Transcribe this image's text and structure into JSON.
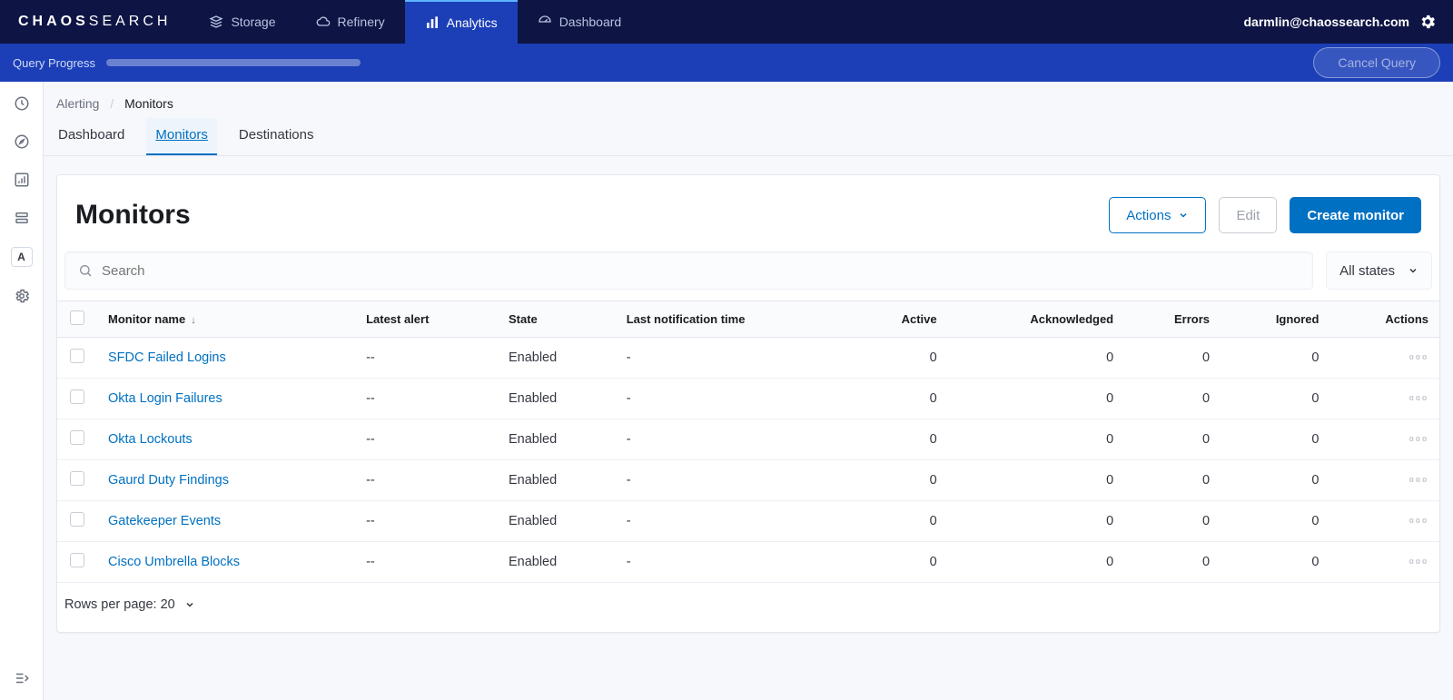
{
  "brand": {
    "part1": "CHAOS",
    "part2": "SEARCH"
  },
  "topnav": {
    "items": [
      {
        "label": "Storage",
        "icon": "storage"
      },
      {
        "label": "Refinery",
        "icon": "cloud"
      },
      {
        "label": "Analytics",
        "icon": "bars",
        "active": true
      },
      {
        "label": "Dashboard",
        "icon": "gauge"
      }
    ],
    "user": "darmlin@chaossearch.com"
  },
  "querybar": {
    "label": "Query Progress",
    "cancel": "Cancel Query"
  },
  "breadcrumb": {
    "root": "Alerting",
    "current": "Monitors"
  },
  "tabs": [
    {
      "label": "Dashboard"
    },
    {
      "label": "Monitors",
      "active": true
    },
    {
      "label": "Destinations"
    }
  ],
  "panel": {
    "title": "Monitors",
    "actions_btn": "Actions",
    "edit_btn": "Edit",
    "create_btn": "Create monitor",
    "search_placeholder": "Search",
    "state_filter": "All states"
  },
  "table": {
    "headers": {
      "name": "Monitor name",
      "latest": "Latest alert",
      "state": "State",
      "last_notif": "Last notification time",
      "active": "Active",
      "ack": "Acknowledged",
      "errors": "Errors",
      "ignored": "Ignored",
      "actions": "Actions"
    },
    "rows": [
      {
        "name": "SFDC Failed Logins",
        "latest": "--",
        "state": "Enabled",
        "last_notif": "-",
        "active": "0",
        "ack": "0",
        "errors": "0",
        "ignored": "0"
      },
      {
        "name": "Okta Login Failures",
        "latest": "--",
        "state": "Enabled",
        "last_notif": "-",
        "active": "0",
        "ack": "0",
        "errors": "0",
        "ignored": "0"
      },
      {
        "name": "Okta Lockouts",
        "latest": "--",
        "state": "Enabled",
        "last_notif": "-",
        "active": "0",
        "ack": "0",
        "errors": "0",
        "ignored": "0"
      },
      {
        "name": "Gaurd Duty Findings",
        "latest": "--",
        "state": "Enabled",
        "last_notif": "-",
        "active": "0",
        "ack": "0",
        "errors": "0",
        "ignored": "0"
      },
      {
        "name": "Gatekeeper Events",
        "latest": "--",
        "state": "Enabled",
        "last_notif": "-",
        "active": "0",
        "ack": "0",
        "errors": "0",
        "ignored": "0"
      },
      {
        "name": "Cisco Umbrella Blocks",
        "latest": "--",
        "state": "Enabled",
        "last_notif": "-",
        "active": "0",
        "ack": "0",
        "errors": "0",
        "ignored": "0"
      }
    ],
    "rows_per_page": "Rows per page: 20"
  },
  "rail_letter": "A"
}
